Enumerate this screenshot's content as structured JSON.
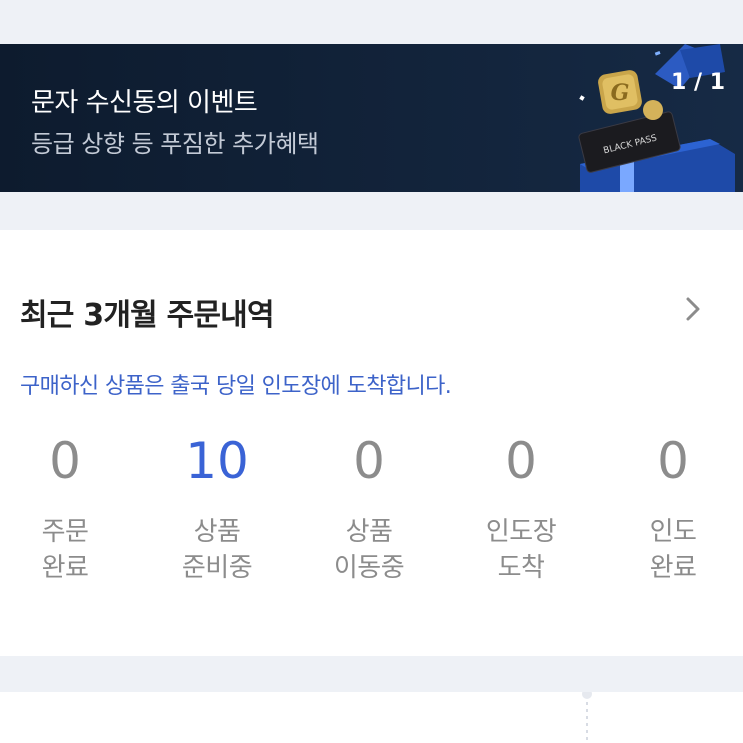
{
  "banner": {
    "title": "문자 수신동의 이벤트",
    "subtitle": "등급 상향 등 푸짐한 추가혜택",
    "counter": "1 / 1",
    "art_icons": [
      "gold-g-coin-icon",
      "black-pass-ticket-icon",
      "gift-box-icon"
    ],
    "ticket_text": "BLACK PASS",
    "coin_letter": "G"
  },
  "orders": {
    "title": "최근 3개월 주문내역",
    "notice": "구매하신 상품은 출국 당일 인도장에 도착합니다.",
    "steps": [
      {
        "count": "0",
        "label": "주문\n완료"
      },
      {
        "count": "10",
        "label": "상품\n준비중"
      },
      {
        "count": "0",
        "label": "상품\n이동중"
      },
      {
        "count": "0",
        "label": "인도장\n도착"
      },
      {
        "count": "0",
        "label": "인도\n완료"
      }
    ],
    "active_color": "#3a63d6",
    "inactive_color": "#8c8c8c"
  }
}
